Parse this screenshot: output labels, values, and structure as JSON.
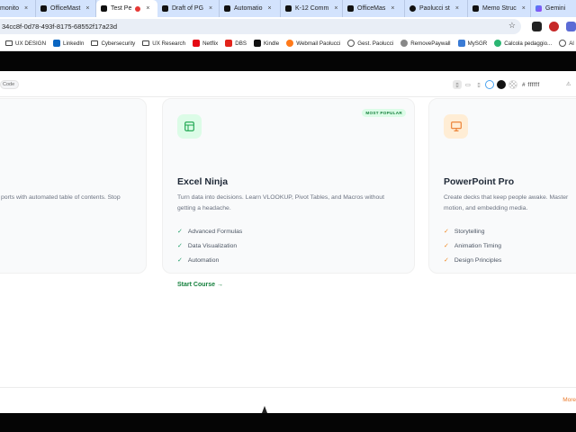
{
  "tabs": [
    {
      "title": "monito"
    },
    {
      "title": "OfficeMast"
    },
    {
      "title": "Test Pe"
    },
    {
      "title": "Draft of PG"
    },
    {
      "title": "Automatio"
    },
    {
      "title": "K-12 Comm"
    },
    {
      "title": "OfficeMas"
    },
    {
      "title": "Paolucci st"
    },
    {
      "title": "Memo Struc"
    },
    {
      "title": "Gemini"
    }
  ],
  "address": {
    "url": "34cc8f-0d78-493f-8175-68552f17a23d"
  },
  "bookmarks": [
    {
      "label": "UX DESIGN"
    },
    {
      "label": "LinkedIn"
    },
    {
      "label": "Cybersecurity"
    },
    {
      "label": "UX Research"
    },
    {
      "label": "Netflix"
    },
    {
      "label": "DBS"
    },
    {
      "label": "Kindle"
    },
    {
      "label": "Webmail Paolucci"
    },
    {
      "label": "Gest. Paolucci"
    },
    {
      "label": "RemovePaywall"
    },
    {
      "label": "MySGR"
    },
    {
      "label": "Calcola pedaggio..."
    },
    {
      "label": "Al"
    }
  ],
  "toolbar": {
    "code_label": "Code",
    "hex_value": "# ffffff"
  },
  "cards": {
    "left": {
      "description": "ports with automated table of contents. Stop"
    },
    "excel": {
      "badge": "MOST POPULAR",
      "title": "Excel Ninja",
      "description": "Turn data into decisions. Learn VLOOKUP, Pivot Tables, and Macros without getting a headache.",
      "features": [
        "Advanced Formulas",
        "Data Visualization",
        "Automation"
      ],
      "cta": "Start Course →"
    },
    "powerpoint": {
      "title": "PowerPoint Pro",
      "description": "Create decks that keep people awake. Master motion, and embedding media.",
      "features": [
        "Storytelling",
        "Animation Timing",
        "Design Principles"
      ]
    }
  },
  "footer": {
    "more_label": "More"
  },
  "colors": {
    "accent_green": "#15803d",
    "accent_orange": "#f08a24",
    "card_bg": "#f9fafb"
  }
}
